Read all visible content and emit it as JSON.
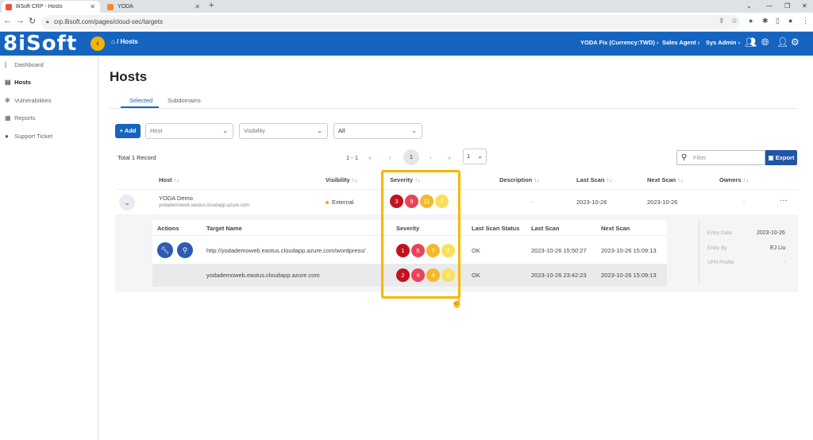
{
  "browser": {
    "tabs": [
      {
        "label": "8iSoft CRP - Hosts",
        "active": true
      },
      {
        "label": "YODA",
        "active": false
      }
    ],
    "url": "crp.8isoft.com/pages/cloud-sec/targets"
  },
  "header": {
    "logo": "8iSoft",
    "breadcrumb": "/ Hosts",
    "org": "YODA Fix (Currency:TWD)",
    "role": "Sales Agent",
    "user": "Sys Admin",
    "accent": "#1565c0"
  },
  "sidebar": {
    "items": [
      {
        "label": "Dashboard",
        "icon": "chart-icon"
      },
      {
        "label": "Hosts",
        "icon": "server-icon"
      },
      {
        "label": "Vulnerabilities",
        "icon": "bug-icon"
      },
      {
        "label": "Reports",
        "icon": "report-icon"
      },
      {
        "label": "Support Ticket",
        "icon": "help-icon"
      }
    ]
  },
  "main": {
    "title": "Hosts",
    "tabs": [
      "Selected",
      "Subdomains"
    ],
    "add_label": "+ Add",
    "filters": {
      "host_placeholder": "Host",
      "visibility_placeholder": "Visibility",
      "all_value": "All"
    },
    "total": "Total 1 Record",
    "pager": {
      "range": "1 - 1",
      "current": "1",
      "page_size": "1"
    },
    "filter_placeholder": "Filter",
    "export_label": "Export",
    "columns": [
      "Host",
      "Visibility",
      "Severity",
      "Description",
      "Last Scan",
      "Next Scan",
      "Owners"
    ],
    "row": {
      "host": "YODA Demo",
      "host_sub": "yodademoweb.eastus.cloudapp.azure.com",
      "visibility": "External",
      "severity": [
        "3",
        "9",
        "11",
        "7"
      ],
      "description": "-",
      "last_scan": "2023-10-26",
      "next_scan": "2023-10-26",
      "owners": "-",
      "more": "···"
    },
    "detail": {
      "columns": [
        "Actions",
        "Target Name",
        "Severity",
        "Last Scan Status",
        "Last Scan",
        "Next Scan"
      ],
      "rows": [
        {
          "target": "http://yodademoweb.eastus.cloudapp.azure.com/wordpress/",
          "severity": [
            "1",
            "5",
            "7",
            "7"
          ],
          "status": "OK",
          "last_scan": "2023-10-26 15:50:27",
          "next_scan": "2023-10-26 15:09:13"
        },
        {
          "target": "yodademoweb.eastus.cloudapp.azure.com",
          "severity": [
            "2",
            "4",
            "4",
            "0"
          ],
          "status": "OK",
          "last_scan": "2023-10-26 23:42:23",
          "next_scan": "2023-10-26 15:09:13"
        }
      ],
      "meta": [
        {
          "label": "Entry Date",
          "value": "2023-10-26"
        },
        {
          "label": "Entry By",
          "value": "EJ Liu"
        },
        {
          "label": "VPN Profile",
          "value": "-"
        }
      ]
    }
  }
}
